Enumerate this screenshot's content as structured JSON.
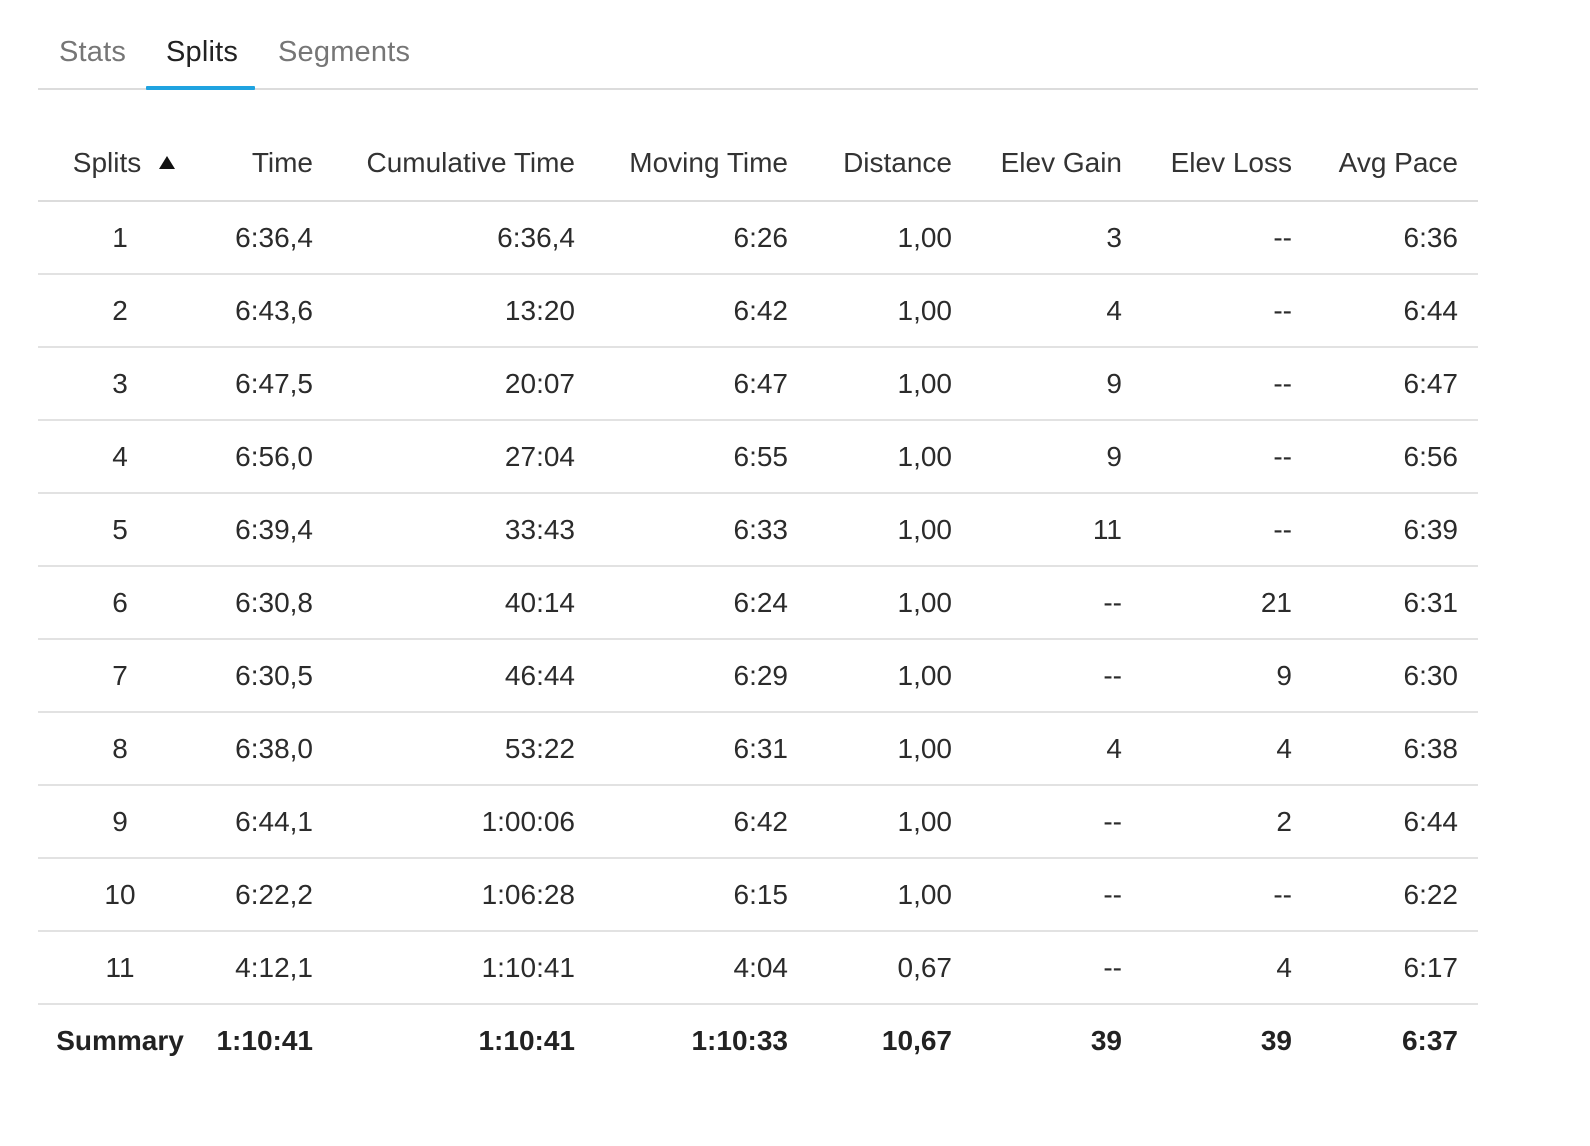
{
  "tabs": [
    {
      "label": "Stats",
      "active": false
    },
    {
      "label": "Splits",
      "active": true
    },
    {
      "label": "Segments",
      "active": false
    }
  ],
  "accent_color": "#1fa3e0",
  "table": {
    "headers": [
      "Splits",
      "Time",
      "Cumulative Time",
      "Moving Time",
      "Distance",
      "Elev Gain",
      "Elev Loss",
      "Avg Pace"
    ],
    "sort_icon": "sort-ascending-icon",
    "rows": [
      [
        "1",
        "6:36,4",
        "6:36,4",
        "6:26",
        "1,00",
        "3",
        "--",
        "6:36"
      ],
      [
        "2",
        "6:43,6",
        "13:20",
        "6:42",
        "1,00",
        "4",
        "--",
        "6:44"
      ],
      [
        "3",
        "6:47,5",
        "20:07",
        "6:47",
        "1,00",
        "9",
        "--",
        "6:47"
      ],
      [
        "4",
        "6:56,0",
        "27:04",
        "6:55",
        "1,00",
        "9",
        "--",
        "6:56"
      ],
      [
        "5",
        "6:39,4",
        "33:43",
        "6:33",
        "1,00",
        "11",
        "--",
        "6:39"
      ],
      [
        "6",
        "6:30,8",
        "40:14",
        "6:24",
        "1,00",
        "--",
        "21",
        "6:31"
      ],
      [
        "7",
        "6:30,5",
        "46:44",
        "6:29",
        "1,00",
        "--",
        "9",
        "6:30"
      ],
      [
        "8",
        "6:38,0",
        "53:22",
        "6:31",
        "1,00",
        "4",
        "4",
        "6:38"
      ],
      [
        "9",
        "6:44,1",
        "1:00:06",
        "6:42",
        "1,00",
        "--",
        "2",
        "6:44"
      ],
      [
        "10",
        "6:22,2",
        "1:06:28",
        "6:15",
        "1,00",
        "--",
        "--",
        "6:22"
      ],
      [
        "11",
        "4:12,1",
        "1:10:41",
        "4:04",
        "0,67",
        "--",
        "4",
        "6:17"
      ]
    ],
    "summary": [
      "Summary",
      "1:10:41",
      "1:10:41",
      "1:10:33",
      "10,67",
      "39",
      "39",
      "6:37"
    ]
  }
}
